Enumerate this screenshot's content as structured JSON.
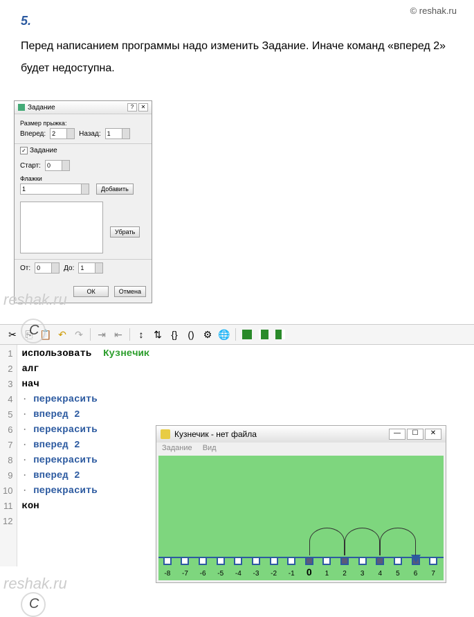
{
  "header": {
    "task_number": "5.",
    "copyright": "© reshak.ru"
  },
  "description": "Перед написанием программы надо изменить Задание. Иначе команд «вперед 2» будет недоступна.",
  "dialog": {
    "title": "Задание",
    "jump_label": "Размер прыжка:",
    "forward_label": "Вперед:",
    "forward_val": "2",
    "back_label": "Назад:",
    "back_val": "1",
    "checkbox_label": "Задание",
    "start_label": "Старт:",
    "start_val": "0",
    "flags_label": "Флажки",
    "flag_val": "1",
    "add_btn": "Добавить",
    "remove_btn": "Убрать",
    "from_label": "От:",
    "from_val": "0",
    "to_label": "До:",
    "to_val": "1",
    "ok": "ОК",
    "cancel": "Отмена"
  },
  "code": {
    "l1_use": "использовать",
    "l1_name": "Кузнечик",
    "l2": "алг",
    "l3": "нач",
    "l4": "перекрасить",
    "l5": "вперед 2",
    "l6": "перекрасить",
    "l7": "вперед 2",
    "l8": "перекрасить",
    "l9": "вперед 2",
    "l10": "перекрасить",
    "l11": "кон"
  },
  "grass": {
    "title": "Кузнечик - нет файла",
    "menu1": "Задание",
    "menu2": "Вид",
    "ticks": [
      -8,
      -7,
      -6,
      -5,
      -4,
      -3,
      -2,
      -1,
      0,
      1,
      2,
      3,
      4,
      5,
      6,
      7
    ],
    "filled": [
      0,
      2,
      4,
      6
    ],
    "current": 6
  },
  "watermark": "reshak.ru"
}
